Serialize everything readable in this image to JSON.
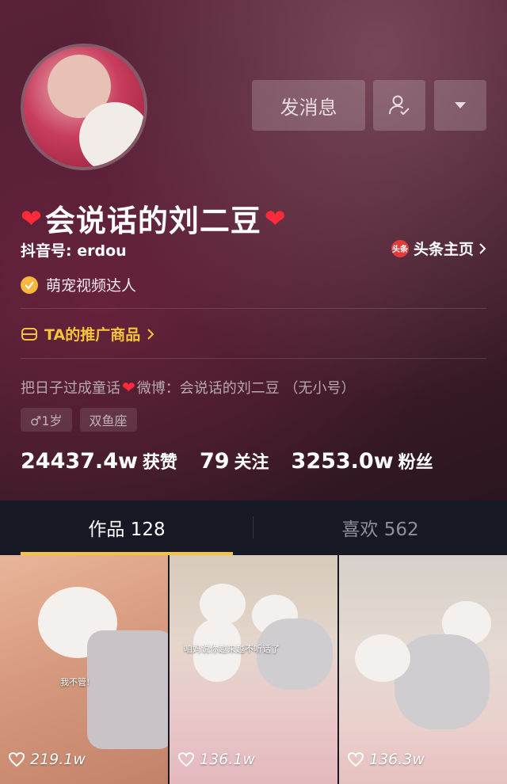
{
  "profile": {
    "nickname": "会说话的刘二豆",
    "douyin_id": "抖音号: erdou",
    "toutiao_label": "头条主页",
    "toutiao_icon_text": "头条",
    "verified_label": "萌宠视频达人",
    "promo_label": "TA的推广商品",
    "bio_prefix": "把日子过成童话",
    "bio_suffix": " 微博：会说话的刘二豆 （无小号）",
    "tags": [
      "♂1岁",
      "双鱼座"
    ],
    "stats": [
      {
        "num": "24437.4w",
        "label": "获赞"
      },
      {
        "num": "79",
        "label": "关注"
      },
      {
        "num": "3253.0w",
        "label": "粉丝"
      }
    ]
  },
  "actions": {
    "message_label": "发消息",
    "follow_icon": "user-check-icon",
    "more_icon": "caret-down-icon"
  },
  "tabs": [
    {
      "label": "作品 128",
      "active": true
    },
    {
      "label": "喜欢 562",
      "active": false
    }
  ],
  "videos": [
    {
      "likes": "219.1w",
      "caption": "我不管!"
    },
    {
      "likes": "136.1w",
      "caption": "咱妈说你越来越不听话了"
    },
    {
      "likes": "136.3w",
      "caption": ""
    }
  ],
  "colors": {
    "accent_yellow": "#f6c43c",
    "heart_red": "#ff2b3a",
    "tab_bg": "#161823"
  }
}
